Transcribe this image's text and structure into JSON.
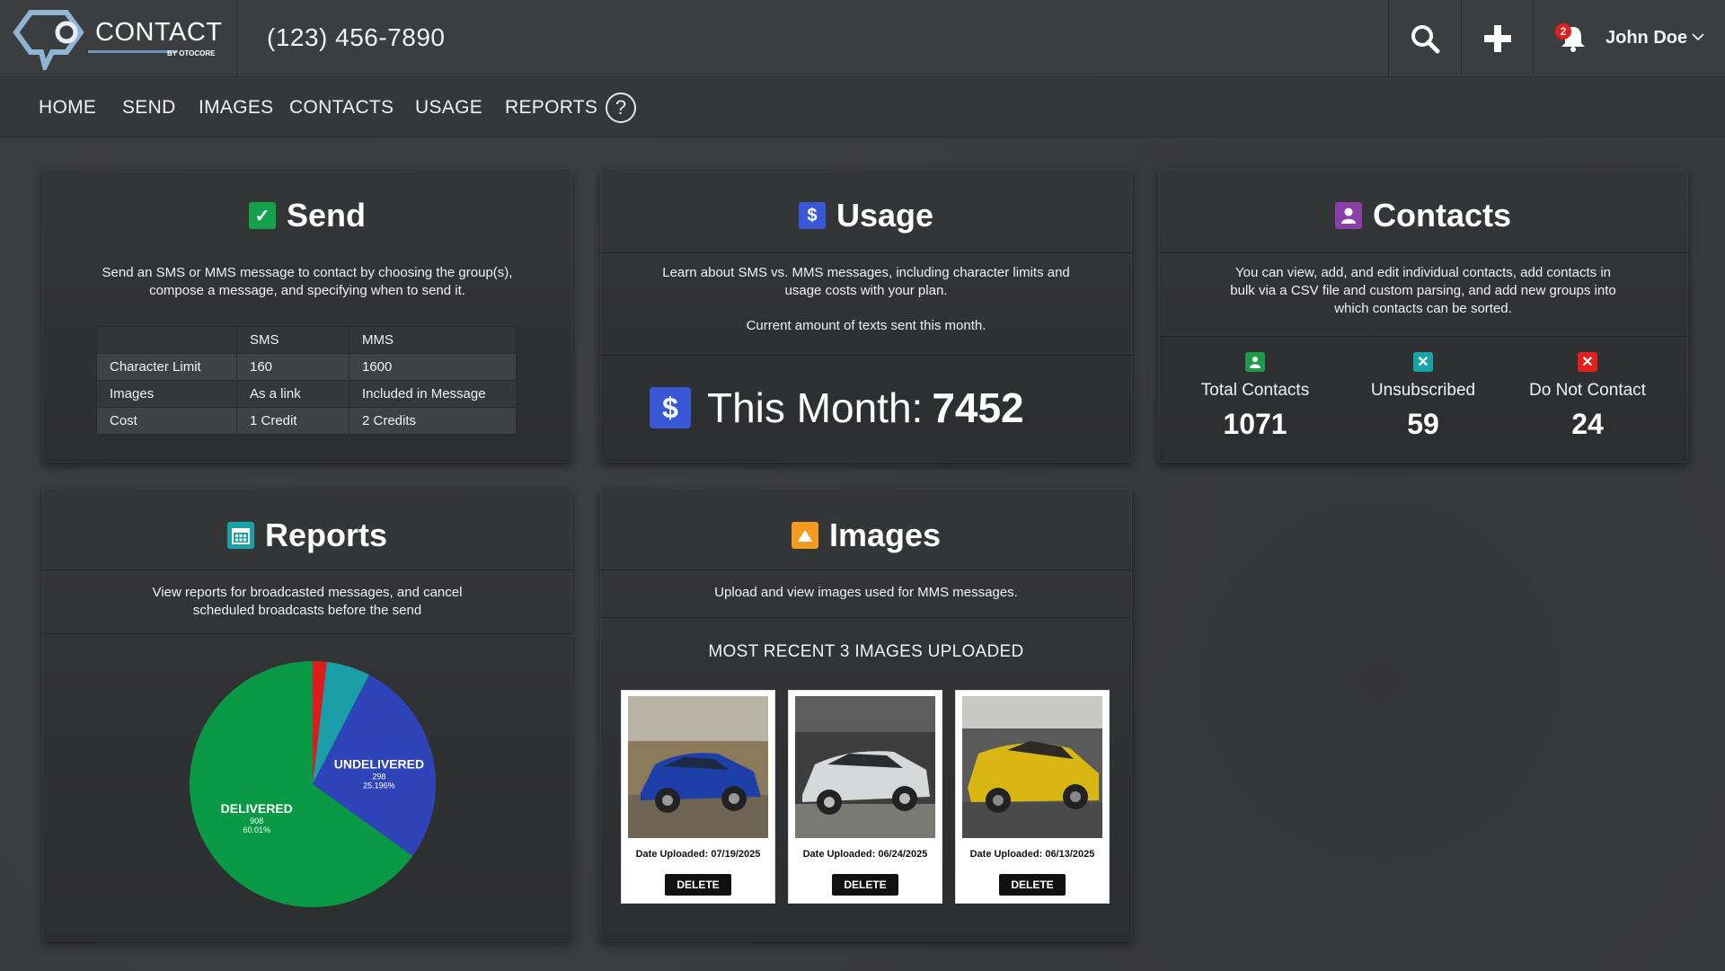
{
  "header": {
    "logo_text": "CONTACT",
    "logo_sub": "BY OTOCORE",
    "phone": "(123) 456-7890",
    "notification_count": "2",
    "user_name": "John Doe"
  },
  "nav": {
    "items": [
      "HOME",
      "SEND",
      "IMAGES",
      "CONTACTS",
      "USAGE",
      "REPORTS"
    ],
    "help_label": "?"
  },
  "send": {
    "title": "Send",
    "description": "Send an SMS or MMS message to contact by choosing the group(s), compose a message, and specifying when to send it.",
    "table": {
      "headers": [
        "",
        "SMS",
        "MMS"
      ],
      "rows": [
        [
          "Character Limit",
          "160",
          "1600"
        ],
        [
          "Images",
          "As a link",
          "Included in Message"
        ],
        [
          "Cost",
          "1 Credit",
          "2 Credits"
        ]
      ]
    }
  },
  "usage": {
    "title": "Usage",
    "description_1": "Learn about SMS vs. MMS messages, including character limits and usage costs with your plan.",
    "description_2": "Current amount of texts sent this month.",
    "this_month_label": "This Month:",
    "this_month_value": "7452"
  },
  "contacts": {
    "title": "Contacts",
    "description": "You can view, add, and edit individual contacts, add contacts in bulk via a CSV file and custom parsing, and add new groups into which contacts can be sorted.",
    "stats": [
      {
        "label": "Total Contacts",
        "value": "1071",
        "color": "#1e9a4a"
      },
      {
        "label": "Unsubscribed",
        "value": "59",
        "color": "#1aa3a6"
      },
      {
        "label": "Do Not Contact",
        "value": "24",
        "color": "#e0201c"
      }
    ]
  },
  "reports": {
    "title": "Reports",
    "description": "View reports for broadcasted messages, and cancel scheduled broadcasts before the send"
  },
  "chart_data": {
    "type": "pie",
    "slices": [
      {
        "label": "DELIVERED",
        "count": "908",
        "percent": "60.01%",
        "value": 60.01,
        "color": "#0a9a45"
      },
      {
        "label": "UNDELIVERED",
        "count": "298",
        "percent": "25.196%",
        "value": 25.196,
        "color": "#2e44b8"
      },
      {
        "label": "",
        "value": 5.3,
        "color": "#1a9fa8"
      },
      {
        "label": "",
        "value": 1.7,
        "color": "#e01b1b"
      }
    ]
  },
  "images": {
    "title": "Images",
    "description": "Upload and view images used for MMS messages.",
    "recent_title": "MOST RECENT 3 IMAGES UPLOADED",
    "items": [
      {
        "date": "Date Uploaded: 07/19/2025",
        "delete": "DELETE",
        "car_color": "#1f3fa8",
        "scene": "#7a6a4a"
      },
      {
        "date": "Date Uploaded: 06/24/2025",
        "delete": "DELETE",
        "car_color": "#d6d8da",
        "scene": "#3a3a3a"
      },
      {
        "date": "Date Uploaded: 06/13/2025",
        "delete": "DELETE",
        "car_color": "#d9b612",
        "scene": "#6a6a6a"
      }
    ]
  },
  "colors": {
    "send_icon": "#11a24a",
    "usage_icon": "#3a58d6",
    "contacts_icon": "#8a3ea6",
    "reports_icon": "#1aa3a6",
    "images_icon": "#f39a1f"
  }
}
